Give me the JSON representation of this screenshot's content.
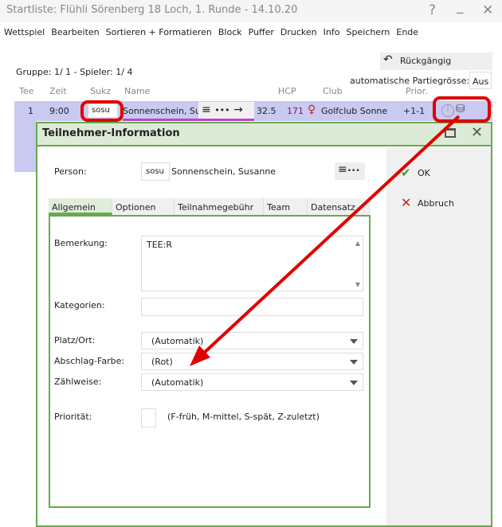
{
  "window": {
    "title": "Startliste: Flühli Sörenberg 18 Loch, 1. Runde - 14.10.20",
    "help": "?",
    "minimize": "_",
    "close": "✕"
  },
  "menu": [
    "Wettspiel",
    "Bearbeiten",
    "Sortieren + Formatieren",
    "Block",
    "Puffer",
    "Drucken",
    "Info",
    "Speichern",
    "Ende"
  ],
  "toolbar": {
    "undo": "Rückgängig",
    "auto_label": "automatische Partiegrösse:",
    "auto_value": "Aus"
  },
  "group_info": "Gruppe:  1/  1 - Spieler:  1/  4",
  "columns": [
    "Tee",
    "Zeit",
    "Sukz",
    "Name",
    "HCP",
    "Club",
    "Prior."
  ],
  "row": {
    "tee": "1",
    "zeit": "9:00",
    "sukz": "sosu",
    "name": "Sonnenschein, Sus",
    "hcp": "32.5",
    "num": "171",
    "club": "Golfclub Sonne",
    "prior": "+1-1"
  },
  "dialog": {
    "title": "Teilnehmer-Information",
    "person_label": "Person:",
    "person_code": "sosu",
    "person_name": "Sonnenschein, Susanne",
    "tabs": [
      "Allgemein",
      "Optionen",
      "Teilnahmegebühr",
      "Team",
      "Datensatz"
    ],
    "bemerkung_label": "Bemerkung:",
    "bemerkung_value": "TEE:R",
    "kategorien_label": "Kategorien:",
    "platz_label": "Platz/Ort:",
    "platz_value": "(Automatik)",
    "farbe_label": "Abschlag-Farbe:",
    "farbe_value": "(Rot)",
    "zaehl_label": "Zählweise:",
    "zaehl_value": "(Automatik)",
    "prio_label": "Priorität:",
    "prio_hint": "(F-früh, M-mittel, S-spät, Z-zuletzt)",
    "ok": "OK",
    "cancel": "Abbruch"
  },
  "colors": {
    "selected_row": "#c9c9f2",
    "dialog_border": "#6aa84f",
    "dialog_header": "#dcebd6",
    "annotation": "#e00000"
  }
}
